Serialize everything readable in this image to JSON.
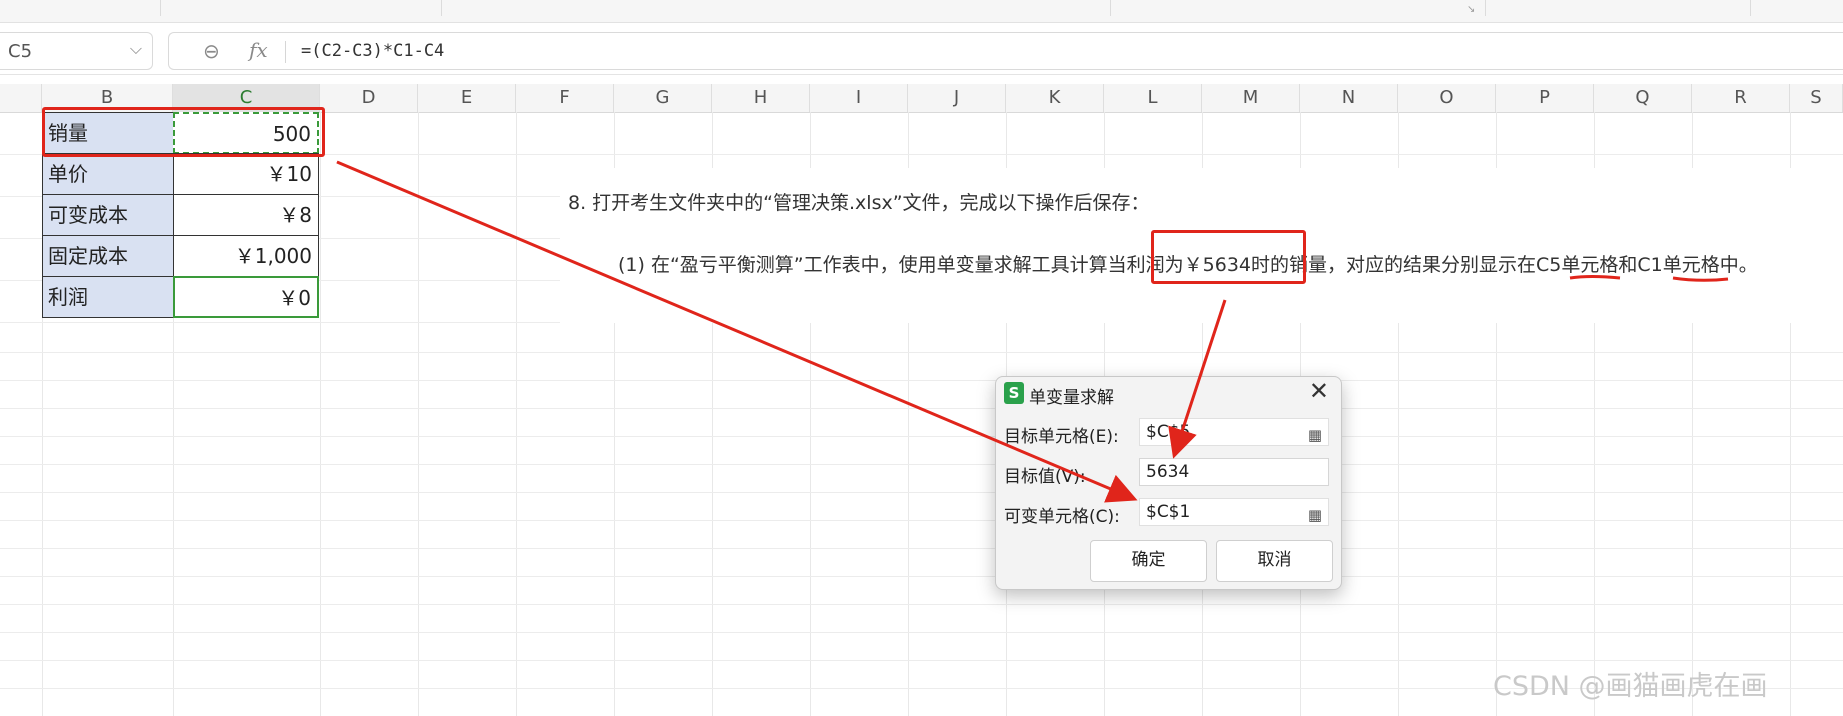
{
  "formula_bar": {
    "name_box": "C5",
    "fx_label": "fx",
    "formula": "=(C2-C3)*C1-C4"
  },
  "columns": [
    "B",
    "C",
    "D",
    "E",
    "F",
    "G",
    "H",
    "I",
    "J",
    "K",
    "L",
    "M",
    "N",
    "O",
    "P",
    "Q",
    "R",
    "S"
  ],
  "table": {
    "rows": [
      {
        "label": "销量",
        "value": "500"
      },
      {
        "label": "单价",
        "value": "￥10"
      },
      {
        "label": "可变成本",
        "value": "￥8"
      },
      {
        "label": "固定成本",
        "value": "￥1,000"
      },
      {
        "label": "利润",
        "value": "￥0"
      }
    ]
  },
  "instructions": {
    "line1": "8.  打开考生文件夹中的“管理决策.xlsx”文件，完成以下操作后保存：",
    "line2": "(1) 在“盈亏平衡测算”工作表中，使用单变量求解工具计算当利润为￥5634时的销量，对应的结果分别显示在C5单元格和C1单元格中。"
  },
  "dialog": {
    "title": "单变量求解",
    "target_cell_label": "目标单元格(E):",
    "target_cell_value": "$C$5",
    "target_value_label": "目标值(V):",
    "target_value": "5634",
    "changing_cell_label": "可变单元格(C):",
    "changing_cell_value": "$C$1",
    "ok_label": "确定",
    "cancel_label": "取消"
  },
  "watermark": "CSDN @画猫画虎在画",
  "colors": {
    "annotation_red": "#e0251b",
    "label_fill": "#d9e1f2",
    "selection_green": "#3a9a3a",
    "logo_green": "#2aa14b"
  }
}
